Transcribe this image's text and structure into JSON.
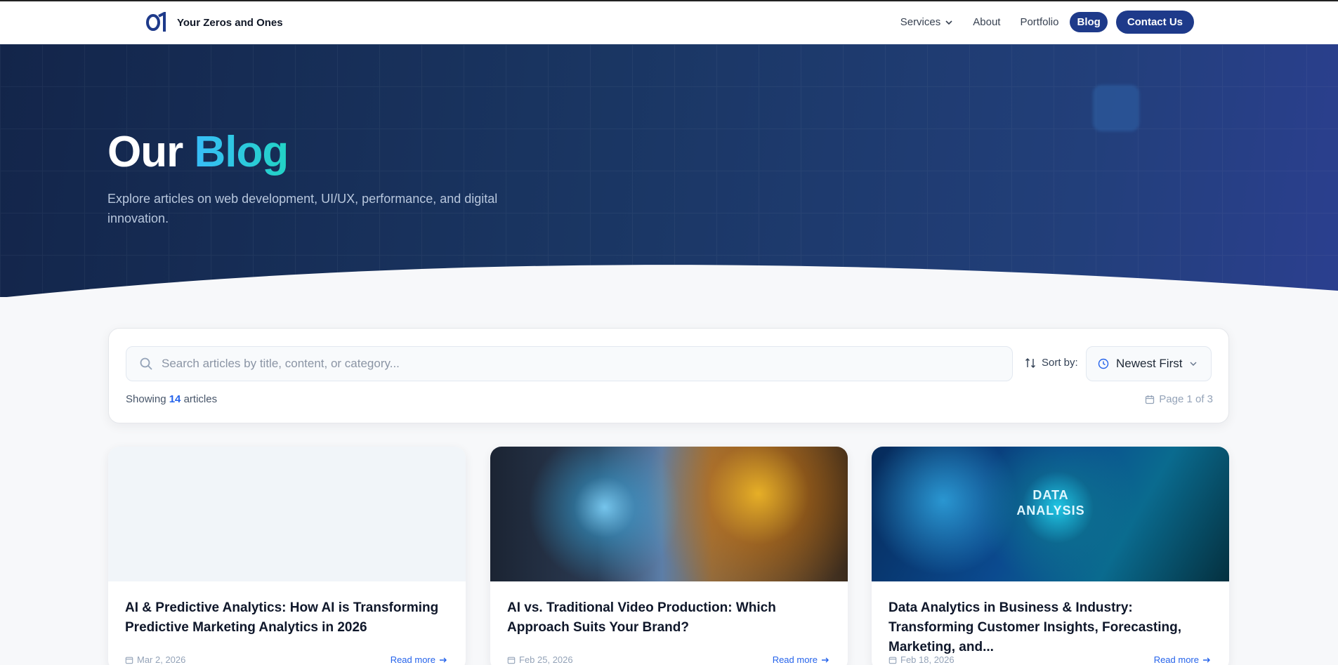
{
  "nav": {
    "brand": "Your Zeros and Ones",
    "items": [
      {
        "label": "Services"
      },
      {
        "label": "About"
      },
      {
        "label": "Portfolio"
      },
      {
        "label": "Blog"
      }
    ],
    "contact_label": "Contact Us"
  },
  "hero": {
    "title_plain": "Our",
    "title_accent": "Blog",
    "subtitle": "Explore articles on web development, UI/UX, performance, and digital innovation."
  },
  "search": {
    "placeholder": "Search articles by title, content, or category...",
    "sort_label": "Sort by:",
    "sort_value": "Newest First",
    "showing_prefix": "Showing",
    "showing_count": "14",
    "showing_suffix": "articles",
    "page_info": "Page 1 of 3"
  },
  "cards": [
    {
      "title": "AI & Predictive Analytics: How AI is Transforming Predictive Marketing Analytics in 2026",
      "date": "Mar 2, 2026",
      "more": "Read more"
    },
    {
      "title": "AI vs. Traditional Video Production: Which Approach Suits Your Brand?",
      "date": "Feb 25, 2026",
      "more": "Read more"
    },
    {
      "title": "Data Analytics in Business & Industry: Transforming Customer Insights, Forecasting, Marketing, and...",
      "date": "Feb 18, 2026",
      "more": "Read more",
      "image_text": "DATA ANALYSIS"
    }
  ],
  "colors": {
    "brand": "#1e3a8a",
    "accent": "#38bdf8",
    "link": "#2563eb"
  }
}
